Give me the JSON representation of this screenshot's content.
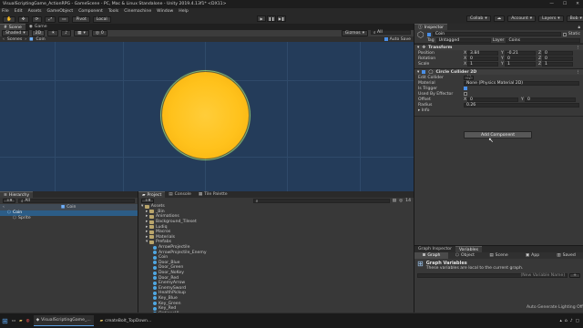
{
  "window": {
    "title": "VisualScriptingGame_ActionRPG - GameScene - PC, Mac & Linux Standalone - Unity 2019.4.13f1* <DX11>"
  },
  "menu": [
    "File",
    "Edit",
    "Assets",
    "GameObject",
    "Component",
    "Tools",
    "Cinemachine",
    "Window",
    "Help"
  ],
  "toolbar": {
    "pivot": "Pivot",
    "local": "Local",
    "collab": "Collab",
    "account": "Account",
    "layers": "Layers",
    "layout": "Bob"
  },
  "scene": {
    "tabs": [
      {
        "label": "Scene"
      },
      {
        "label": "Game"
      }
    ],
    "shading": "Shaded",
    "mode2d": "2D",
    "gizmos": "Gizmos",
    "search_placeholder": "All",
    "breadcrumb_scenes": "Scenes",
    "breadcrumb_object": "Coin",
    "auto_save": "Auto Save"
  },
  "inspector": {
    "tab": "Inspector",
    "static": "Static",
    "object_name": "Coin",
    "tag_label": "Tag",
    "tag_value": "Untagged",
    "layer_label": "Layer",
    "layer_value": "Coins",
    "transform": {
      "title": "Transform",
      "rows": [
        {
          "label": "Position",
          "x": "3.84",
          "y": "-0.21",
          "z": "0"
        },
        {
          "label": "Rotation",
          "x": "0",
          "y": "0",
          "z": "0"
        },
        {
          "label": "Scale",
          "x": "1",
          "y": "1",
          "z": "1"
        }
      ]
    },
    "collider": {
      "title": "Circle Collider 2D",
      "edit_label": "Edit Collider",
      "material_label": "Material",
      "material_value": "None (Physics Material 2D)",
      "trigger_label": "Is Trigger",
      "trigger": true,
      "effector_label": "Used By Effector",
      "effector": false,
      "offset_label": "Offset",
      "offset_x": "0",
      "offset_y": "0",
      "radius_label": "Radius",
      "radius_value": "0.26",
      "info_label": "Info"
    },
    "add_component": "Add Component"
  },
  "hierarchy": {
    "tab": "Hierarchy",
    "search_placeholder": "All",
    "scene": "Coin",
    "items": [
      {
        "label": "Coin",
        "selected": true
      },
      {
        "label": "Sprite",
        "selected": false
      }
    ]
  },
  "project": {
    "tabs": [
      "Project",
      "Console",
      "Tile Palette"
    ],
    "count": "14",
    "root": "Assets",
    "folders": [
      "_Bin",
      "Animations",
      "Background_Tileset",
      "Ludiq",
      "Macros",
      "Materials",
      "Prefabs"
    ],
    "prefabs": [
      "ArrowProjectile",
      "ArrowProjectile_Enemy",
      "Coin",
      "Door_Blue",
      "Door_Green",
      "Door_NoKey",
      "Door_Red",
      "EnemyArrow",
      "EnemySword",
      "HealthPickup",
      "Key_Blue",
      "Key_Green",
      "Key_Red",
      "OptionsUI"
    ]
  },
  "graph": {
    "tabs": [
      "Graph Inspector",
      "Variables"
    ],
    "scopes": [
      "Graph",
      "Object",
      "Scene",
      "App",
      "Saved"
    ],
    "heading": "Graph Variables",
    "description": "These variables are local to the current graph.",
    "new_placeholder": "(New Variable Name)"
  },
  "status": "Auto Generate Lighting Off",
  "taskbar": {
    "items": [
      "VisualScriptingGame_...",
      "createBolt_TopDown..."
    ]
  },
  "colors": {
    "viewport": "#243c5a",
    "coin": "#ffc21c",
    "accent": "#4a8fe7"
  }
}
